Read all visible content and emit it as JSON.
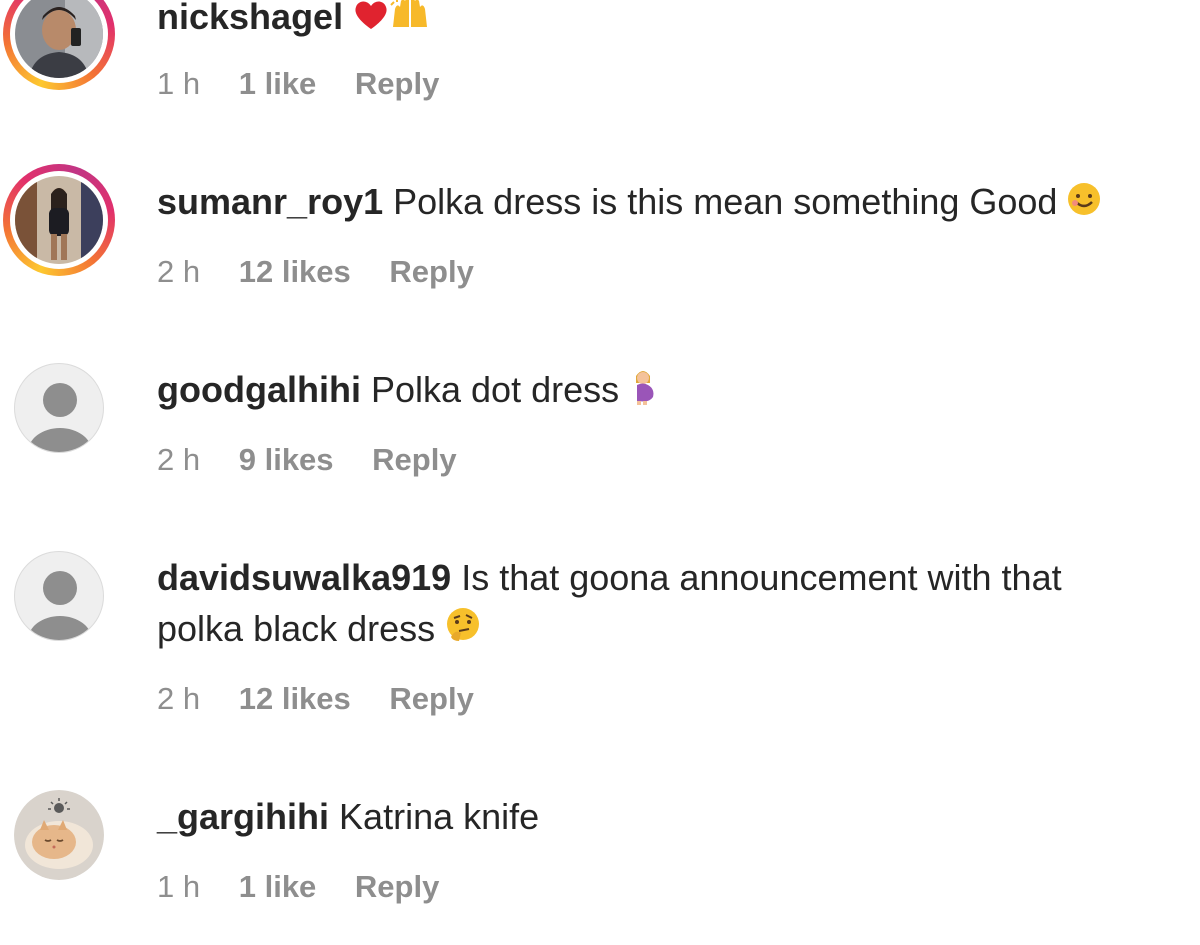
{
  "comments": [
    {
      "username": "nickshagel",
      "text": "",
      "emoji": [
        "heart-emoji",
        "raising-hands-emoji"
      ],
      "time": "1 h",
      "likes": "1 like",
      "reply": "Reply",
      "avatar": "photo-man"
    },
    {
      "username": "sumanr_roy1",
      "text": "Polka dress is this mean something Good",
      "emoji": [
        "smiling-face-emoji"
      ],
      "time": "2 h",
      "likes": "12 likes",
      "reply": "Reply",
      "avatar": "photo-woman"
    },
    {
      "username": "goodgalhihi",
      "text": "Polka dot dress",
      "emoji": [
        "pregnant-woman-emoji"
      ],
      "time": "2 h",
      "likes": "9 likes",
      "reply": "Reply",
      "avatar": "default"
    },
    {
      "username": "davidsuwalka919",
      "text": "Is that goona announcement with that",
      "text_line2": "polka black dress",
      "emoji": [
        "thinking-face-emoji"
      ],
      "time": "2 h",
      "likes": "12 likes",
      "reply": "Reply",
      "avatar": "default"
    },
    {
      "username": "_gargihihi",
      "text": "Katrina knife",
      "emoji": [],
      "time": "1 h",
      "likes": "1 like",
      "reply": "Reply",
      "avatar": "photo-cat"
    }
  ],
  "colors": {
    "username": "#262626",
    "meta": "#8e8e8e",
    "story_ring": [
      "#fdc830",
      "#f37335",
      "#e1306c",
      "#c13584"
    ]
  }
}
